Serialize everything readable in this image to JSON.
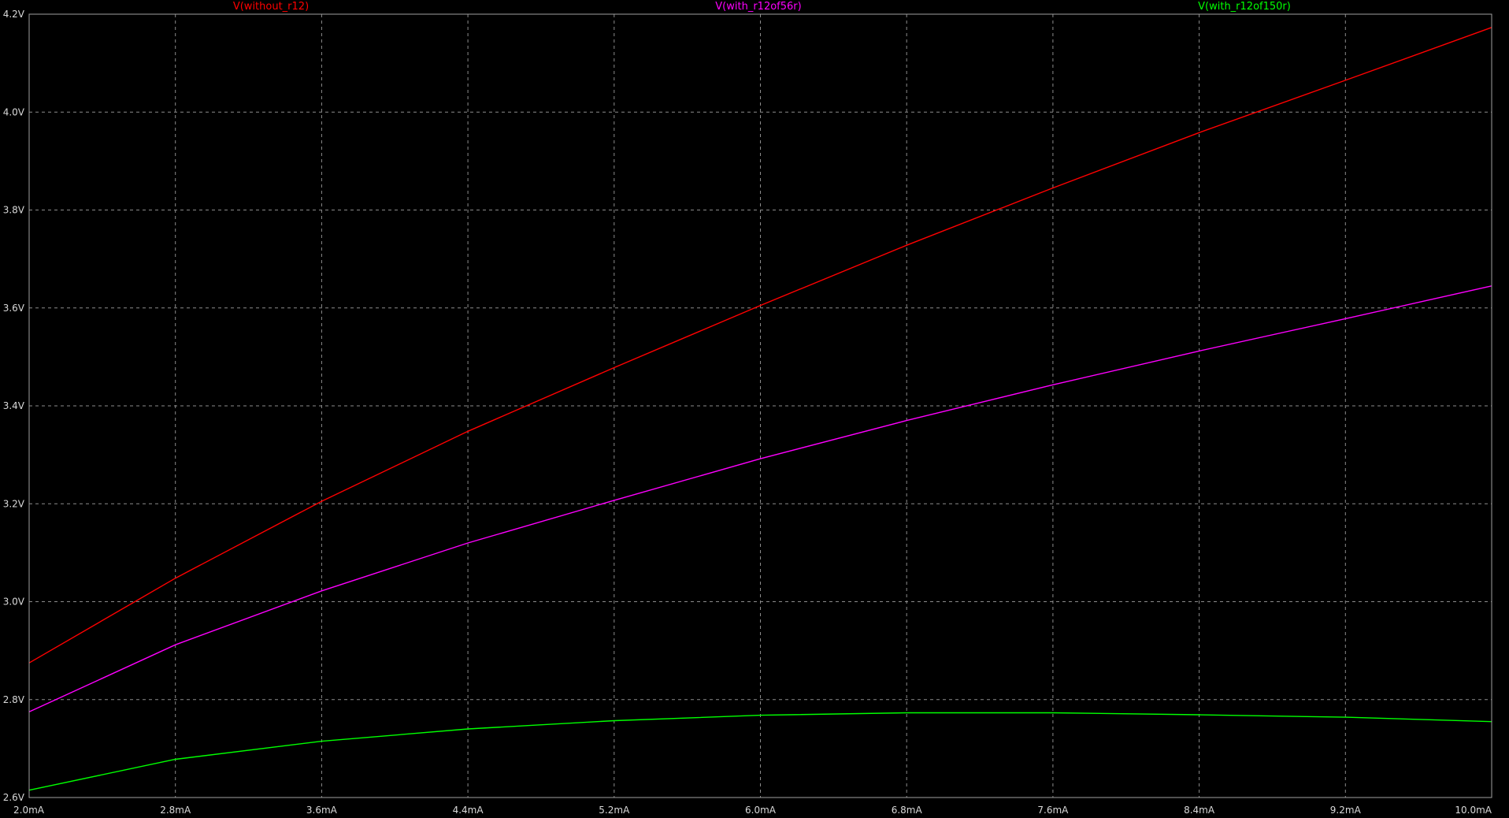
{
  "chart_data": {
    "type": "line",
    "title": "",
    "xlabel": "",
    "ylabel": "",
    "xlim": [
      2.0,
      10.0
    ],
    "ylim": [
      2.6,
      4.2
    ],
    "x_ticks": [
      2.0,
      2.8,
      3.6,
      4.4,
      5.2,
      6.0,
      6.8,
      7.6,
      8.4,
      9.2,
      10.0
    ],
    "x_tick_labels": [
      "2.0mA",
      "2.8mA",
      "3.6mA",
      "4.4mA",
      "5.2mA",
      "6.0mA",
      "6.8mA",
      "7.6mA",
      "8.4mA",
      "9.2mA",
      "10.0mA"
    ],
    "y_ticks": [
      2.6,
      2.8,
      3.0,
      3.2,
      3.4,
      3.6,
      3.8,
      4.0,
      4.2
    ],
    "y_tick_labels": [
      "2.6V",
      "2.8V",
      "3.0V",
      "3.2V",
      "3.4V",
      "3.6V",
      "3.8V",
      "4.0V",
      "4.2V"
    ],
    "grid": true,
    "legend": "top",
    "background": "#000000",
    "x": [
      2.0,
      2.8,
      3.6,
      4.4,
      5.2,
      6.0,
      6.8,
      7.6,
      8.4,
      9.2,
      10.0
    ],
    "series": [
      {
        "name": "V(without_r12)",
        "color": "#ff0000",
        "values": [
          2.875,
          3.048,
          3.205,
          3.348,
          3.478,
          3.605,
          3.728,
          3.845,
          3.958,
          4.065,
          4.173
        ]
      },
      {
        "name": "V(with_r12of56r)",
        "color": "#ff00ff",
        "values": [
          2.775,
          2.912,
          3.022,
          3.12,
          3.207,
          3.292,
          3.37,
          3.443,
          3.512,
          3.578,
          3.645
        ]
      },
      {
        "name": "V(with_r12of150r)",
        "color": "#00ff00",
        "values": [
          2.615,
          2.678,
          2.715,
          2.74,
          2.757,
          2.768,
          2.773,
          2.773,
          2.769,
          2.764,
          2.755
        ]
      }
    ]
  }
}
